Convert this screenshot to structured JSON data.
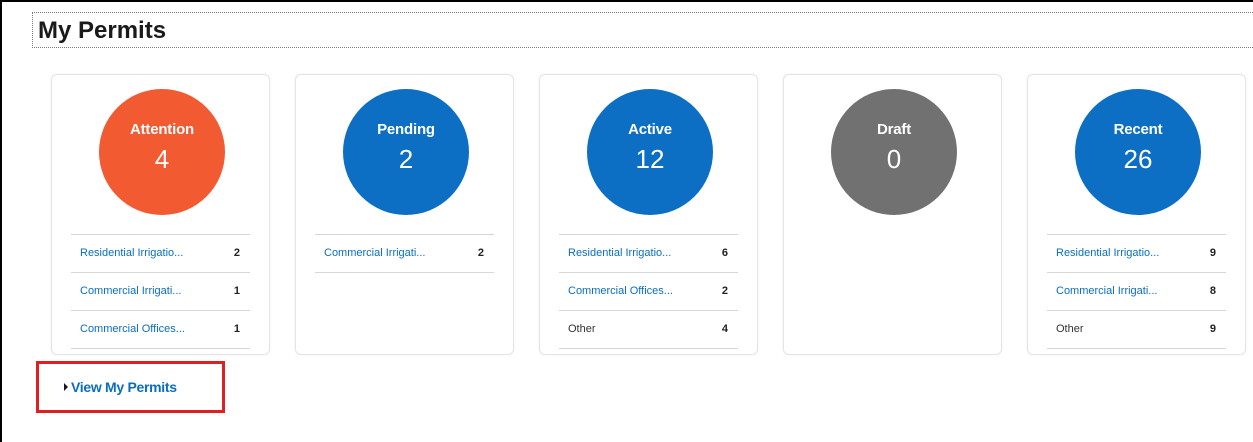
{
  "page_title": "My Permits",
  "colors": {
    "attention": "#f25a32",
    "pending": "#0d6fc4",
    "active": "#0d6fc4",
    "draft": "#717171",
    "recent": "#0d6fc4",
    "link": "#0a6ebd",
    "highlight": "#e02020"
  },
  "cards": [
    {
      "label": "Attention",
      "count": "4",
      "rows": [
        {
          "label": "Residential Irrigatio...",
          "count": "2",
          "link": true
        },
        {
          "label": "Commercial Irrigati...",
          "count": "1",
          "link": true
        },
        {
          "label": "Commercial Offices...",
          "count": "1",
          "link": true
        }
      ]
    },
    {
      "label": "Pending",
      "count": "2",
      "rows": [
        {
          "label": "Commercial Irrigati...",
          "count": "2",
          "link": true
        }
      ]
    },
    {
      "label": "Active",
      "count": "12",
      "rows": [
        {
          "label": "Residential Irrigatio...",
          "count": "6",
          "link": true
        },
        {
          "label": "Commercial Offices...",
          "count": "2",
          "link": true
        },
        {
          "label": "Other",
          "count": "4",
          "link": false
        }
      ]
    },
    {
      "label": "Draft",
      "count": "0",
      "rows": []
    },
    {
      "label": "Recent",
      "count": "26",
      "rows": [
        {
          "label": "Residential Irrigatio...",
          "count": "9",
          "link": true
        },
        {
          "label": "Commercial Irrigati...",
          "count": "8",
          "link": true
        },
        {
          "label": "Other",
          "count": "9",
          "link": false
        }
      ]
    }
  ],
  "view_link": {
    "label": "View My Permits",
    "icon": "caret-right-icon"
  }
}
